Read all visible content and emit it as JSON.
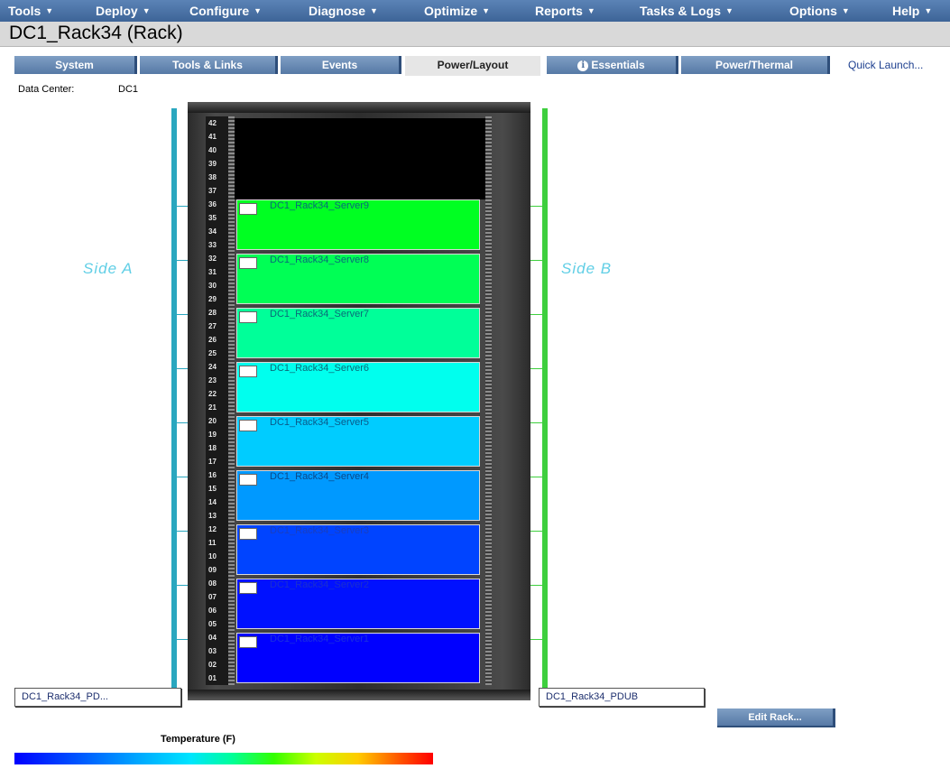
{
  "menu": [
    {
      "label": "Tools"
    },
    {
      "label": "Deploy"
    },
    {
      "label": "Configure"
    },
    {
      "label": "Diagnose"
    },
    {
      "label": "Optimize"
    },
    {
      "label": "Reports"
    },
    {
      "label": "Tasks & Logs"
    },
    {
      "label": "Options"
    },
    {
      "label": "Help"
    }
  ],
  "page_title": "DC1_Rack34 (Rack)",
  "tabs": [
    {
      "label": "System"
    },
    {
      "label": "Tools & Links"
    },
    {
      "label": "Events"
    },
    {
      "label": "Power/Layout"
    },
    {
      "label": "Essentials"
    },
    {
      "label": "Power/Thermal"
    }
  ],
  "active_tab": "Power/Layout",
  "quick_launch": "Quick Launch...",
  "data_center": {
    "label": "Data Center:",
    "value": "DC1"
  },
  "sides": {
    "a": "Side A",
    "b": "Side B"
  },
  "rack_units": [
    "42",
    "41",
    "40",
    "39",
    "38",
    "37",
    "36",
    "35",
    "34",
    "33",
    "32",
    "31",
    "30",
    "29",
    "28",
    "27",
    "26",
    "25",
    "24",
    "23",
    "22",
    "21",
    "20",
    "19",
    "18",
    "17",
    "16",
    "15",
    "14",
    "13",
    "12",
    "11",
    "10",
    "09",
    "08",
    "07",
    "06",
    "05",
    "04",
    "03",
    "02",
    "01"
  ],
  "servers": [
    {
      "name": "DC1_Rack34_Server9",
      "color": "#00ff22",
      "text_color": "#0a6a7a"
    },
    {
      "name": "DC1_Rack34_Server8",
      "color": "#00ff55",
      "text_color": "#0a6a7a"
    },
    {
      "name": "DC1_Rack34_Server7",
      "color": "#00ff99",
      "text_color": "#0a6a7a"
    },
    {
      "name": "DC1_Rack34_Server6",
      "color": "#00ffee",
      "text_color": "#0a6a7a"
    },
    {
      "name": "DC1_Rack34_Server5",
      "color": "#00ccff",
      "text_color": "#0a5a8a"
    },
    {
      "name": "DC1_Rack34_Server4",
      "color": "#0099ff",
      "text_color": "#0a4a8a"
    },
    {
      "name": "DC1_Rack34_Server3",
      "color": "#0044ff",
      "text_color": "#1a3fbf"
    },
    {
      "name": "DC1_Rack34_Server2",
      "color": "#0011ff",
      "text_color": "#1a2fcf"
    },
    {
      "name": "DC1_Rack34_Server1",
      "color": "#0000ff",
      "text_color": "#1a2fdf"
    }
  ],
  "pdus": {
    "a": "DC1_Rack34_PD...",
    "b": "DC1_Rack34_PDUB"
  },
  "edit_rack_label": "Edit Rack...",
  "legend": {
    "title": "Temperature (F)"
  }
}
